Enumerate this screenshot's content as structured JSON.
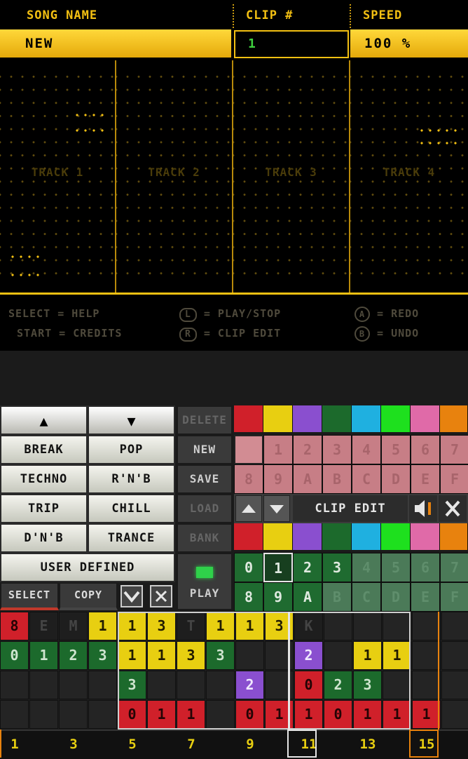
{
  "header": {
    "song_name_label": "SONG NAME",
    "clip_label": "CLIP #",
    "speed_label": "SPEED",
    "song_name_value": "NEW",
    "clip_value": "1",
    "speed_value": "100 %"
  },
  "tracks": [
    "TRACK 1",
    "TRACK 2",
    "TRACK 3",
    "TRACK 4"
  ],
  "help": {
    "select": "SELECT = HELP",
    "start": "START = CREDITS",
    "l_key": "L",
    "l_action": "= PLAY/STOP",
    "r_key": "R",
    "r_action": "= CLIP EDIT",
    "a_key": "A",
    "a_action": "= REDO",
    "b_key": "B",
    "b_action": "= UNDO"
  },
  "styles": {
    "up_label": "▲",
    "down_label": "▼",
    "items": [
      "BREAK",
      "POP",
      "TECHNO",
      "R'N'B",
      "TRIP",
      "CHILL",
      "D'N'B",
      "TRANCE"
    ],
    "user_defined": "USER DEFINED",
    "select": "SELECT",
    "copy": "COPY"
  },
  "actions": {
    "delete": "DELETE",
    "new": "NEW",
    "save": "SAVE",
    "load": "LOAD",
    "bank": "BANK",
    "play": "PLAY"
  },
  "clip_edit": {
    "label": "CLIP EDIT",
    "up_icon": "up-arrow-icon",
    "down_icon": "down-arrow-icon",
    "speaker_icon": "speaker-icon",
    "close_icon": "close-icon"
  },
  "palette": [
    "#d0202a",
    "#e8cf11",
    "#8a4fcf",
    "#1c6a2c",
    "#1fb0e0",
    "#1ee01e",
    "#e06aa8",
    "#e8820e"
  ],
  "song_slots": [
    "1",
    "2",
    "3",
    "4",
    "5",
    "6",
    "7",
    "8",
    "9",
    "A",
    "B",
    "C",
    "D",
    "E",
    "F"
  ],
  "bank_slots": {
    "row1": [
      "0",
      "1",
      "2",
      "3",
      "4",
      "5",
      "6",
      "7"
    ],
    "row2": [
      "8",
      "9",
      "A",
      "B",
      "C",
      "D",
      "E",
      "F"
    ]
  },
  "sequencer": {
    "row1": [
      {
        "t": "8",
        "c": "red"
      },
      {
        "t": "E",
        "c": "mute"
      },
      {
        "t": "M",
        "c": "mute"
      },
      {
        "t": "1",
        "c": "yel"
      },
      {
        "t": "1",
        "c": "yel"
      },
      {
        "t": "3",
        "c": "yel"
      },
      {
        "t": "T",
        "c": "mute"
      },
      {
        "t": "1",
        "c": "yel"
      },
      {
        "t": "1",
        "c": "yel"
      },
      {
        "t": "3",
        "c": "yel"
      },
      {
        "t": "K",
        "c": "mute"
      },
      {
        "t": "",
        "c": "blank"
      },
      {
        "t": "",
        "c": "blank"
      },
      {
        "t": "",
        "c": "blank"
      },
      {
        "t": "",
        "c": "blank"
      },
      {
        "t": "",
        "c": "blank"
      }
    ],
    "row2": [
      {
        "t": "0",
        "c": "grn"
      },
      {
        "t": "1",
        "c": "grn"
      },
      {
        "t": "2",
        "c": "grn"
      },
      {
        "t": "3",
        "c": "grn"
      },
      {
        "t": "1",
        "c": "yel"
      },
      {
        "t": "1",
        "c": "yel"
      },
      {
        "t": "3",
        "c": "yel"
      },
      {
        "t": "3",
        "c": "grn"
      },
      {
        "t": "",
        "c": "blank"
      },
      {
        "t": "",
        "c": "blank"
      },
      {
        "t": "2",
        "c": "pur"
      },
      {
        "t": "",
        "c": "blank"
      },
      {
        "t": "1",
        "c": "yel"
      },
      {
        "t": "1",
        "c": "yel"
      },
      {
        "t": "",
        "c": "blank"
      },
      {
        "t": "",
        "c": "blank"
      }
    ],
    "row3": [
      {
        "t": "",
        "c": "blank"
      },
      {
        "t": "",
        "c": "blank"
      },
      {
        "t": "",
        "c": "blank"
      },
      {
        "t": "",
        "c": "blank"
      },
      {
        "t": "3",
        "c": "grn"
      },
      {
        "t": "",
        "c": "blank"
      },
      {
        "t": "",
        "c": "blank"
      },
      {
        "t": "",
        "c": "blank"
      },
      {
        "t": "2",
        "c": "pur"
      },
      {
        "t": "",
        "c": "blank"
      },
      {
        "t": "0",
        "c": "red"
      },
      {
        "t": "2",
        "c": "grn"
      },
      {
        "t": "3",
        "c": "grn"
      },
      {
        "t": "",
        "c": "blank"
      },
      {
        "t": "",
        "c": "blank"
      },
      {
        "t": "",
        "c": "blank"
      }
    ],
    "row4": [
      {
        "t": "",
        "c": "blank"
      },
      {
        "t": "",
        "c": "blank"
      },
      {
        "t": "",
        "c": "blank"
      },
      {
        "t": "",
        "c": "blank"
      },
      {
        "t": "0",
        "c": "red"
      },
      {
        "t": "1",
        "c": "red"
      },
      {
        "t": "1",
        "c": "red"
      },
      {
        "t": "",
        "c": "blank"
      },
      {
        "t": "0",
        "c": "red"
      },
      {
        "t": "1",
        "c": "red"
      },
      {
        "t": "1",
        "c": "red"
      },
      {
        "t": "0",
        "c": "red"
      },
      {
        "t": "1",
        "c": "red"
      },
      {
        "t": "1",
        "c": "red"
      },
      {
        "t": "1",
        "c": "red"
      },
      {
        "t": "",
        "c": "blank"
      }
    ]
  },
  "step_labels": [
    "1",
    "3",
    "5",
    "7",
    "9",
    "11",
    "13",
    "15"
  ]
}
